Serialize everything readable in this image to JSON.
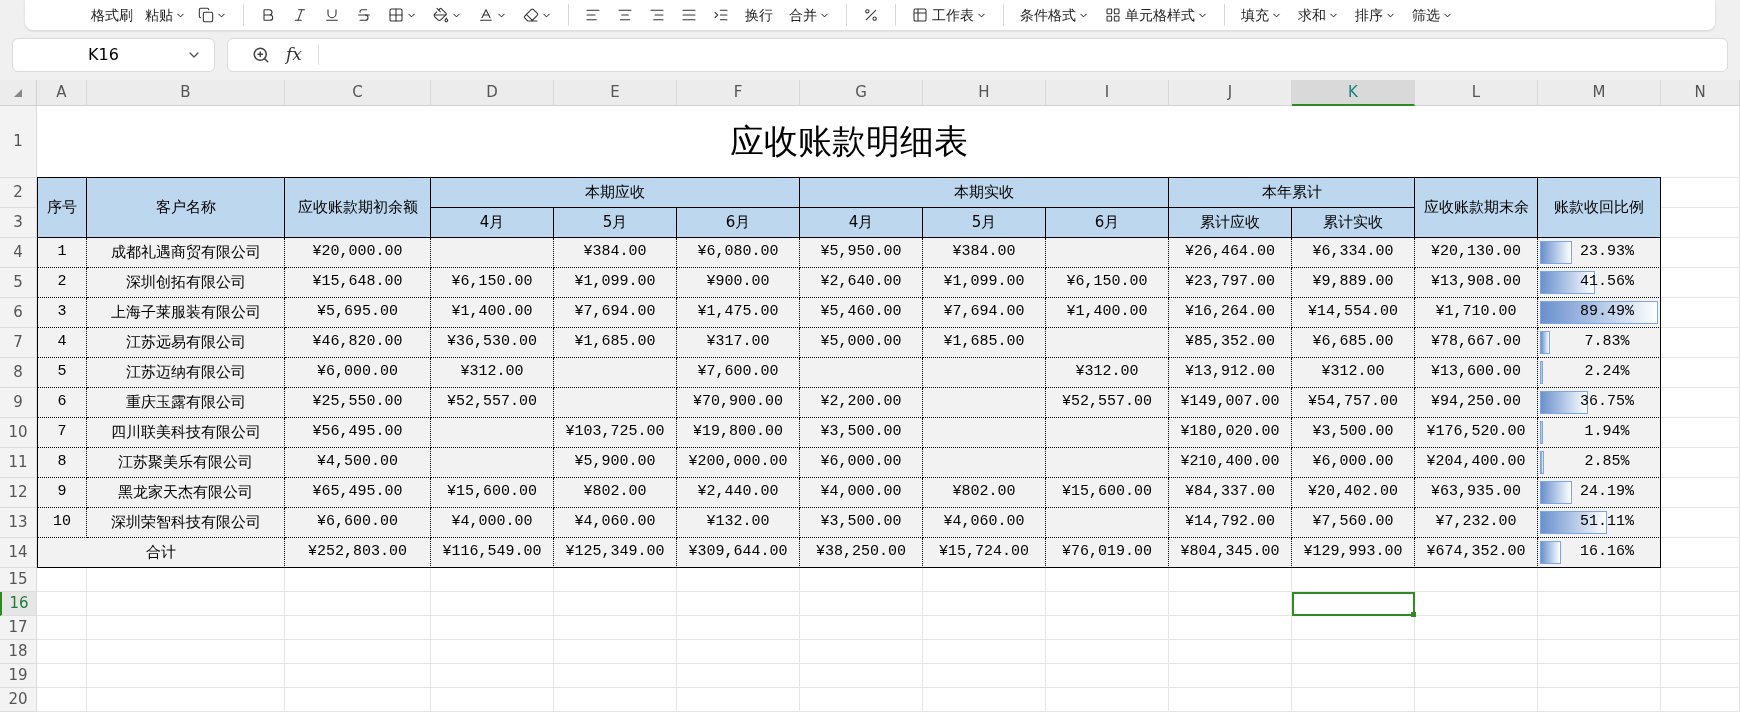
{
  "toolbar": {
    "labels": [
      "格式刷",
      "粘贴",
      "换行",
      "合并",
      "工作表",
      "条件格式",
      "单元格样式",
      "填充",
      "求和",
      "排序",
      "筛选"
    ]
  },
  "name_box": "K16",
  "function_label": "fx",
  "columns": [
    {
      "label": "A",
      "selected": false
    },
    {
      "label": "B",
      "selected": false
    },
    {
      "label": "C",
      "selected": false
    },
    {
      "label": "D",
      "selected": false
    },
    {
      "label": "E",
      "selected": false
    },
    {
      "label": "F",
      "selected": false
    },
    {
      "label": "G",
      "selected": false
    },
    {
      "label": "H",
      "selected": false
    },
    {
      "label": "I",
      "selected": false
    },
    {
      "label": "J",
      "selected": false
    },
    {
      "label": "K",
      "selected": true
    },
    {
      "label": "L",
      "selected": false
    },
    {
      "label": "M",
      "selected": false
    },
    {
      "label": "N",
      "selected": false
    }
  ],
  "row_headers": [
    {
      "label": "1",
      "selected": false
    },
    {
      "label": "2",
      "selected": false
    },
    {
      "label": "3",
      "selected": false
    },
    {
      "label": "4",
      "selected": false
    },
    {
      "label": "5",
      "selected": false
    },
    {
      "label": "6",
      "selected": false
    },
    {
      "label": "7",
      "selected": false
    },
    {
      "label": "8",
      "selected": false
    },
    {
      "label": "9",
      "selected": false
    },
    {
      "label": "10",
      "selected": false
    },
    {
      "label": "11",
      "selected": false
    },
    {
      "label": "12",
      "selected": false
    },
    {
      "label": "13",
      "selected": false
    },
    {
      "label": "14",
      "selected": false
    },
    {
      "label": "15",
      "selected": false
    },
    {
      "label": "16",
      "selected": true
    },
    {
      "label": "17",
      "selected": false
    },
    {
      "label": "18",
      "selected": false
    },
    {
      "label": "19",
      "selected": false
    },
    {
      "label": "20",
      "selected": false
    }
  ],
  "title": "应收账款明细表",
  "header": {
    "left": [
      "序号",
      "客户名称",
      "应收账款期初余额"
    ],
    "groups": [
      {
        "label": "本期应收",
        "subs": [
          "4月",
          "5月",
          "6月"
        ]
      },
      {
        "label": "本期实收",
        "subs": [
          "4月",
          "5月",
          "6月"
        ]
      },
      {
        "label": "本年累计",
        "subs": [
          "累计应收",
          "累计实收"
        ]
      }
    ],
    "right": [
      "应收账款期末余",
      "账款收回比例"
    ]
  },
  "rows": [
    {
      "no": "1",
      "customer": "成都礼遇商贸有限公司",
      "opening": "¥20,000.00",
      "due_may": "¥384.00",
      "due_jun": "¥6,080.00",
      "paid_apr": "¥5,950.00",
      "paid_may": "¥384.00",
      "ytd_due": "¥26,464.00",
      "ytd_paid": "¥6,334.00",
      "closing": "¥20,130.00",
      "ratio": "23.93%",
      "level": 0.267
    },
    {
      "no": "2",
      "customer": "深圳创拓有限公司",
      "opening": "¥15,648.00",
      "due_apr": "¥6,150.00",
      "due_may": "¥1,099.00",
      "due_jun": "¥900.00",
      "paid_apr": "¥2,640.00",
      "paid_may": "¥1,099.00",
      "paid_jun": "¥6,150.00",
      "ytd_due": "¥23,797.00",
      "ytd_paid": "¥9,889.00",
      "closing": "¥13,908.00",
      "ratio": "41.56%",
      "level": 0.464
    },
    {
      "no": "3",
      "customer": "上海子莱服装有限公司",
      "opening": "¥5,695.00",
      "due_apr": "¥1,400.00",
      "due_may": "¥7,694.00",
      "due_jun": "¥1,475.00",
      "paid_apr": "¥5,460.00",
      "paid_may": "¥7,694.00",
      "paid_jun": "¥1,400.00",
      "ytd_due": "¥16,264.00",
      "ytd_paid": "¥14,554.00",
      "closing": "¥1,710.00",
      "ratio": "89.49%",
      "level": 1
    },
    {
      "no": "4",
      "customer": "江苏远易有限公司",
      "opening": "¥46,820.00",
      "due_apr": "¥36,530.00",
      "due_may": "¥1,685.00",
      "due_jun": "¥317.00",
      "paid_apr": "¥5,000.00",
      "paid_may": "¥1,685.00",
      "ytd_due": "¥85,352.00",
      "ytd_paid": "¥6,685.00",
      "closing": "¥78,667.00",
      "ratio": "7.83%",
      "level": 0.087
    },
    {
      "no": "5",
      "customer": "江苏迈纳有限公司",
      "opening": "¥6,000.00",
      "due_apr": "¥312.00",
      "due_jun": "¥7,600.00",
      "paid_jun": "¥312.00",
      "ytd_due": "¥13,912.00",
      "ytd_paid": "¥312.00",
      "closing": "¥13,600.00",
      "ratio": "2.24%",
      "level": 0.025
    },
    {
      "no": "6",
      "customer": "重庆玉露有限公司",
      "opening": "¥25,550.00",
      "due_apr": "¥52,557.00",
      "due_jun": "¥70,900.00",
      "paid_apr": "¥2,200.00",
      "paid_jun": "¥52,557.00",
      "ytd_due": "¥149,007.00",
      "ytd_paid": "¥54,757.00",
      "closing": "¥94,250.00",
      "ratio": "36.75%",
      "level": 0.411
    },
    {
      "no": "7",
      "customer": "四川联美科技有限公司",
      "opening": "¥56,495.00",
      "due_may": "¥103,725.00",
      "due_jun": "¥19,800.00",
      "paid_apr": "¥3,500.00",
      "ytd_due": "¥180,020.00",
      "ytd_paid": "¥3,500.00",
      "closing": "¥176,520.00",
      "ratio": "1.94%",
      "level": 0.022
    },
    {
      "no": "8",
      "customer": "江苏聚美乐有限公司",
      "opening": "¥4,500.00",
      "due_may": "¥5,900.00",
      "due_jun": "¥200,000.00",
      "paid_apr": "¥6,000.00",
      "ytd_due": "¥210,400.00",
      "ytd_paid": "¥6,000.00",
      "closing": "¥204,400.00",
      "ratio": "2.85%",
      "level": 0.032
    },
    {
      "no": "9",
      "customer": "黑龙家天杰有限公司",
      "opening": "¥65,495.00",
      "due_apr": "¥15,600.00",
      "due_may": "¥802.00",
      "due_jun": "¥2,440.00",
      "paid_apr": "¥4,000.00",
      "paid_may": "¥802.00",
      "paid_jun": "¥15,600.00",
      "ytd_due": "¥84,337.00",
      "ytd_paid": "¥20,402.00",
      "closing": "¥63,935.00",
      "ratio": "24.19%",
      "level": 0.27
    },
    {
      "no": "10",
      "customer": "深圳荣智科技有限公司",
      "opening": "¥6,600.00",
      "due_apr": "¥4,000.00",
      "due_may": "¥4,060.00",
      "due_jun": "¥132.00",
      "paid_apr": "¥3,500.00",
      "paid_may": "¥4,060.00",
      "ytd_due": "¥14,792.00",
      "ytd_paid": "¥7,560.00",
      "closing": "¥7,232.00",
      "ratio": "51.11%",
      "level": 0.571
    }
  ],
  "total": {
    "label": "合计",
    "opening": "¥252,803.00",
    "due_apr": "¥116,549.00",
    "due_may": "¥125,349.00",
    "due_jun": "¥309,644.00",
    "paid_apr": "¥38,250.00",
    "paid_may": "¥15,724.00",
    "paid_jun": "¥76,019.00",
    "ytd_due": "¥804,345.00",
    "ytd_paid": "¥129,993.00",
    "closing": "¥674,352.00",
    "ratio": "16.16%",
    "level": 0.181
  }
}
